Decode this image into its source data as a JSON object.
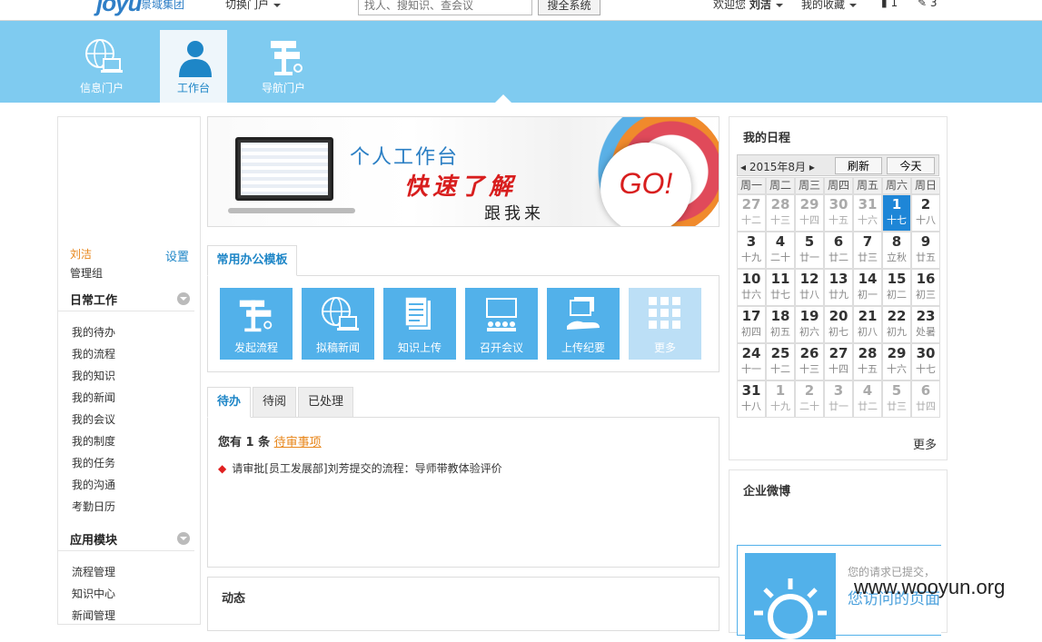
{
  "topbar": {
    "logo": "joyu",
    "logo_text": "景域集团",
    "portal_switch": "切换门户",
    "search_placeholder": "找人、搜知识、查会议",
    "search_button": "搜全系统",
    "welcome": "欢迎您",
    "user": "刘洁",
    "favorites": "我的收藏",
    "doc_count": "1",
    "edit_count": "3"
  },
  "nav": {
    "tabs": [
      {
        "label": "信息门户",
        "icon": "globe-laptop-icon"
      },
      {
        "label": "工作台",
        "icon": "person-icon"
      },
      {
        "label": "导航门户",
        "icon": "signpost-icon"
      }
    ]
  },
  "sidebar": {
    "username": "刘洁",
    "settings": "设置",
    "group": "管理组",
    "daily": {
      "title": "日常工作",
      "items": [
        "我的待办",
        "我的流程",
        "我的知识",
        "我的新闻",
        "我的会议",
        "我的制度",
        "我的任务",
        "我的沟通",
        "考勤日历"
      ]
    },
    "modules": {
      "title": "应用模块",
      "items": [
        "流程管理",
        "知识中心",
        "新闻管理"
      ]
    }
  },
  "promo": {
    "title": "个人工作台",
    "subtitle": "快速了解",
    "subtitle2": "跟我来",
    "go": "GO!"
  },
  "templates": {
    "tab": "常用办公模板",
    "items": [
      {
        "label": "发起流程",
        "icon": "signpost-icon"
      },
      {
        "label": "拟稿新闻",
        "icon": "globe-laptop-icon"
      },
      {
        "label": "知识上传",
        "icon": "document-icon"
      },
      {
        "label": "召开会议",
        "icon": "meeting-icon"
      },
      {
        "label": "上传纪要",
        "icon": "upload-hand-icon"
      },
      {
        "label": "更多",
        "icon": "grid-icon"
      }
    ]
  },
  "tasks": {
    "tabs": [
      "待办",
      "待阅",
      "已处理"
    ],
    "summary_prefix": "您有 1 条",
    "summary_link": "待审事项",
    "item": "请审批[员工发展部]刘芳提交的流程：导师带教体验评价"
  },
  "dynamics": {
    "title": "动态"
  },
  "schedule": {
    "title": "我的日程",
    "month": "2015年8月",
    "refresh": "刷新",
    "today": "今天",
    "weekdays": [
      "周一",
      "周二",
      "周三",
      "周四",
      "周五",
      "周六",
      "周日"
    ],
    "weeks": [
      [
        [
          "27",
          "十二",
          1
        ],
        [
          "28",
          "十三",
          1
        ],
        [
          "29",
          "十四",
          1
        ],
        [
          "30",
          "十五",
          1
        ],
        [
          "31",
          "十六",
          1
        ],
        [
          "1",
          "十七",
          2
        ],
        [
          "2",
          "十八",
          0
        ]
      ],
      [
        [
          "3",
          "十九",
          0
        ],
        [
          "4",
          "二十",
          0
        ],
        [
          "5",
          "廿一",
          0
        ],
        [
          "6",
          "廿二",
          0
        ],
        [
          "7",
          "廿三",
          0
        ],
        [
          "8",
          "立秋",
          0
        ],
        [
          "9",
          "廿五",
          0
        ]
      ],
      [
        [
          "10",
          "廿六",
          0
        ],
        [
          "11",
          "廿七",
          0
        ],
        [
          "12",
          "廿八",
          0
        ],
        [
          "13",
          "廿九",
          0
        ],
        [
          "14",
          "初一",
          0
        ],
        [
          "15",
          "初二",
          0
        ],
        [
          "16",
          "初三",
          0
        ]
      ],
      [
        [
          "17",
          "初四",
          0
        ],
        [
          "18",
          "初五",
          0
        ],
        [
          "19",
          "初六",
          0
        ],
        [
          "20",
          "初七",
          0
        ],
        [
          "21",
          "初八",
          0
        ],
        [
          "22",
          "初九",
          0
        ],
        [
          "23",
          "处暑",
          0
        ]
      ],
      [
        [
          "24",
          "十一",
          0
        ],
        [
          "25",
          "十二",
          0
        ],
        [
          "26",
          "十三",
          0
        ],
        [
          "27",
          "十四",
          0
        ],
        [
          "28",
          "十五",
          0
        ],
        [
          "29",
          "十六",
          0
        ],
        [
          "30",
          "十七",
          0
        ]
      ],
      [
        [
          "31",
          "十八",
          0
        ],
        [
          "1",
          "十九",
          1
        ],
        [
          "2",
          "二十",
          1
        ],
        [
          "3",
          "廿一",
          1
        ],
        [
          "4",
          "廿二",
          1
        ],
        [
          "5",
          "廿三",
          1
        ],
        [
          "6",
          "廿四",
          1
        ]
      ]
    ],
    "more": "更多"
  },
  "weibo": {
    "title": "企业微博",
    "msg": "您的请求已提交，",
    "msg2": "您访问的页面"
  },
  "watermark": "www.wooyun.org"
}
